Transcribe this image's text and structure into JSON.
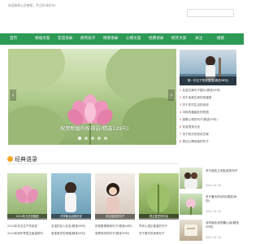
{
  "header": {
    "welcome_text": "欢迎来到心灵感悟，专注好词好句！",
    "search_placeholder": ""
  },
  "nav": {
    "items": [
      {
        "label": "首页"
      },
      {
        "label": "祝福文案"
      },
      {
        "label": "友谊语录"
      },
      {
        "label": "搞笑段子"
      },
      {
        "label": "情感语录"
      },
      {
        "label": "心情文案"
      },
      {
        "label": "经典语录"
      },
      {
        "label": "搞笑文案"
      },
      {
        "label": "关注"
      },
      {
        "label": "搜索"
      }
    ]
  },
  "carousel": {
    "caption": "祝贺新婚的祝福语(精选129句)",
    "prev_label": "‹",
    "next_label": "›",
    "dot_count": 5,
    "active_dot": 0
  },
  "side_feature": {
    "caption": "唯一天空下的祝福语(精选38句)"
  },
  "side_list": [
    {
      "num": "1",
      "text": "友谊文案句子图片(精选35句)"
    },
    {
      "num": "2",
      "text": "关于亲戚生病的祝福语"
    },
    {
      "num": "3",
      "text": "关于农村生活的说说"
    },
    {
      "num": "4",
      "text": "中秋祝福朋友的短语"
    },
    {
      "num": "5",
      "text": "感恩父母的句子(精选35句)"
    },
    {
      "num": "6",
      "text": "友谊语录大全"
    },
    {
      "num": "7",
      "text": "关于秋天的说说文案"
    },
    {
      "num": "8",
      "text": "表达心情低落的句子"
    }
  ],
  "section": {
    "title": "经典语录"
  },
  "thumbs": [
    {
      "caption": "2024年元旦祝福语"
    },
    {
      "caption": "同学聚会经典说说"
    },
    {
      "caption": "毕业感言的句子"
    },
    {
      "caption": "表达爱意的情话"
    }
  ],
  "bottom_rows": [
    [
      "2024年农业生产的说说",
      "友谊的名人名言(精选28句)",
      "伤感爱情唯美句子(精选46句)",
      "早安心语正能量的句子"
    ],
    [
      "2024年新年寄语正能量短句",
      "宝宝周岁的祝福(精选39句)",
      "感恩妈妈的句子(精选39句)",
      "关于春天的优美句子"
    ]
  ],
  "side_cards": [
    {
      "title": "关于朋友之间友谊的句子",
      "date": "2024-01-10"
    },
    {
      "title": "关于春天的诗句(精选38句)",
      "date": "2024-01-10"
    },
    {
      "title": "对好朋友说的暖心话(精选35句)",
      "date": "2024-01-10"
    }
  ],
  "colors": {
    "nav_bg": "#2d9a56",
    "accent_num": "#d1442c",
    "section_icon": "#f5a623"
  }
}
